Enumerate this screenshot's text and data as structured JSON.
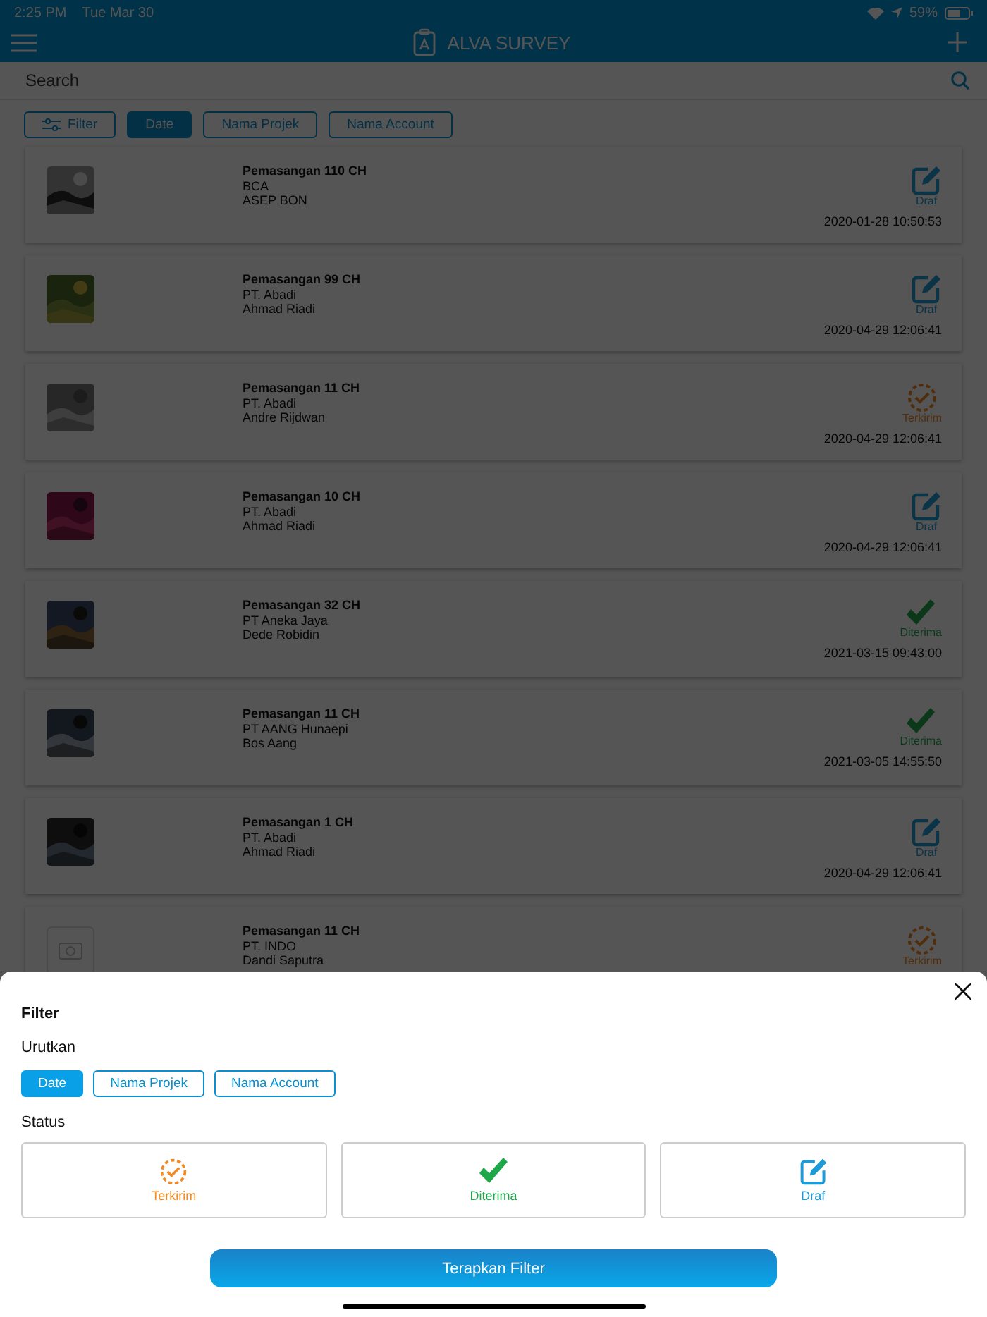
{
  "status_bar": {
    "time": "2:25 PM",
    "date": "Tue Mar 30",
    "battery": "59%"
  },
  "header": {
    "title": "ALVA SURVEY"
  },
  "search": {
    "placeholder": "Search"
  },
  "chips": [
    {
      "label": "Filter",
      "kind": "filter",
      "selected": false
    },
    {
      "label": "Date",
      "kind": "sort",
      "selected": true
    },
    {
      "label": "Nama Projek",
      "kind": "sort",
      "selected": false
    },
    {
      "label": "Nama Account",
      "kind": "sort",
      "selected": false
    }
  ],
  "surveys": [
    {
      "title": "Pemasangan 110 CH",
      "company": "BCA",
      "person": "ASEP BON",
      "status": {
        "kind": "draf",
        "label": "Draf"
      },
      "date": "2020-01-28 10:50:53",
      "photo": true
    },
    {
      "title": "Pemasangan 99 CH",
      "company": "PT. Abadi",
      "person": "Ahmad Riadi",
      "status": {
        "kind": "draf",
        "label": "Draf"
      },
      "date": "2020-04-29 12:06:41",
      "photo": true
    },
    {
      "title": "Pemasangan 11 CH",
      "company": "PT. Abadi",
      "person": "Andre Rijdwan",
      "status": {
        "kind": "terkirim",
        "label": "Terkirim"
      },
      "date": "2020-04-29 12:06:41",
      "photo": true
    },
    {
      "title": "Pemasangan 10 CH",
      "company": "PT. Abadi",
      "person": "Ahmad Riadi",
      "status": {
        "kind": "draf",
        "label": "Draf"
      },
      "date": "2020-04-29 12:06:41",
      "photo": true
    },
    {
      "title": "Pemasangan 32 CH",
      "company": "PT Aneka Jaya",
      "person": "Dede Robidin",
      "status": {
        "kind": "diterima",
        "label": "Diterima"
      },
      "date": "2021-03-15 09:43:00",
      "photo": true
    },
    {
      "title": "Pemasangan 11 CH",
      "company": "PT AANG Hunaepi",
      "person": "Bos Aang",
      "status": {
        "kind": "diterima",
        "label": "Diterima"
      },
      "date": "2021-03-05 14:55:50",
      "photo": true
    },
    {
      "title": "Pemasangan 1 CH",
      "company": "PT. Abadi",
      "person": "Ahmad Riadi",
      "status": {
        "kind": "draf",
        "label": "Draf"
      },
      "date": "2020-04-29 12:06:41",
      "photo": true
    },
    {
      "title": "Pemasangan 11 CH",
      "company": "PT. INDO",
      "person": "Dandi Saputra",
      "status": {
        "kind": "terkirim",
        "label": "Terkirim"
      },
      "photo": false
    }
  ],
  "filter_sheet": {
    "title": "Filter",
    "sort_label": "Urutkan",
    "sort_options": [
      {
        "label": "Date",
        "selected": true
      },
      {
        "label": "Nama Projek",
        "selected": false
      },
      {
        "label": "Nama Account",
        "selected": false
      }
    ],
    "status_label": "Status",
    "status_options": [
      {
        "kind": "terkirim",
        "label": "Terkirim",
        "selected": false
      },
      {
        "kind": "diterima",
        "label": "Diterima",
        "selected": false
      },
      {
        "kind": "draf",
        "label": "Draf",
        "selected": false
      }
    ],
    "apply_button": "Terapkan Filter"
  }
}
